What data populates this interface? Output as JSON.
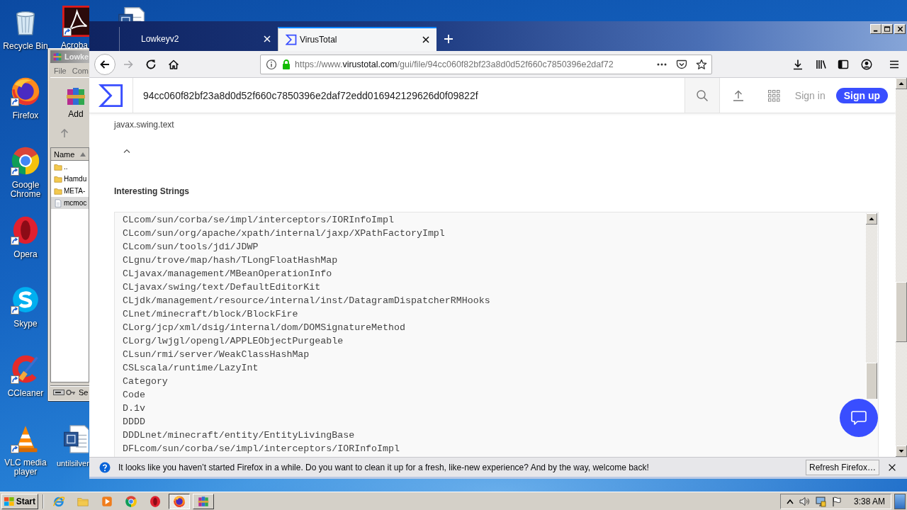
{
  "desktop_icons": [
    {
      "label": "Recycle Bin",
      "kind": "bin",
      "shortcut": false
    },
    {
      "label": "Firefox",
      "kind": "firefox",
      "shortcut": true
    },
    {
      "label": "Google Chrome",
      "kind": "chrome",
      "shortcut": true
    },
    {
      "label": "Opera",
      "kind": "opera",
      "shortcut": true
    },
    {
      "label": "Skype",
      "kind": "skype",
      "shortcut": true
    },
    {
      "label": "CCleaner",
      "kind": "ccleaner",
      "shortcut": true
    },
    {
      "label": "VLC media player",
      "kind": "vlc",
      "shortcut": true
    }
  ],
  "desktop_icons_partly_hidden": [
    {
      "label": "Acroba",
      "kind": "pdf",
      "shortcut": true
    },
    {
      "kind": "document",
      "shortcut": false
    },
    {
      "label": "untilsilver",
      "kind": "document",
      "shortcut": false
    }
  ],
  "archive_window": {
    "title": "Lowke",
    "menu": [
      "File",
      "Com"
    ],
    "toolbar": [
      "Add"
    ],
    "column": "Name",
    "files": [
      {
        "name": "..",
        "kind": "folder",
        "selected": false
      },
      {
        "name": "Hamdu",
        "kind": "folder",
        "selected": false
      },
      {
        "name": "META-",
        "kind": "folder",
        "selected": false
      },
      {
        "name": "mcmoc",
        "kind": "file",
        "selected": true
      }
    ],
    "status": "Se"
  },
  "browser": {
    "tabs": [
      {
        "label": "Lowkeyv2",
        "icon": false,
        "selected": false
      },
      {
        "label": "VirusTotal",
        "icon": true,
        "selected": true
      }
    ],
    "nav_buttons": [
      {
        "kind": "back",
        "disabled": false
      },
      {
        "kind": "forward",
        "disabled": true
      },
      {
        "kind": "reload",
        "disabled": false
      },
      {
        "kind": "home",
        "disabled": false
      }
    ],
    "url": [
      {
        "text": "https://www.",
        "emphasis": false
      },
      {
        "text": "virustotal.com",
        "emphasis": true
      },
      {
        "text": "/gui/file/94cc060f82bf23a8d0d52f660c7850396e2daf72",
        "emphasis": false
      }
    ]
  },
  "page": {
    "search_value": "94cc060f82bf23a8d0d52f660c7850396e2daf72edd016942129626d0f09822f",
    "sign_in": "Sign in",
    "sign_up": "Sign up",
    "previous_entry": "javax.swing.text",
    "section_title": "Interesting Strings",
    "strings": [
      "CLcom/sun/corba/se/impl/interceptors/IORInfoImpl",
      "CLcom/sun/org/apache/xpath/internal/jaxp/XPathFactoryImpl",
      "CLcom/sun/tools/jdi/JDWP",
      "CLgnu/trove/map/hash/TLongFloatHashMap",
      "CLjavax/management/MBeanOperationInfo",
      "CLjavax/swing/text/DefaultEditorKit",
      "CLjdk/management/resource/internal/inst/DatagramDispatcherRMHooks",
      "CLnet/minecraft/block/BlockFire",
      "CLorg/jcp/xml/dsig/internal/dom/DOMSignatureMethod",
      "CLorg/lwjgl/opengl/APPLEObjectPurgeable",
      "CLsun/rmi/server/WeakClassHashMap",
      "CSLscala/runtime/LazyInt",
      "Category",
      "Code",
      "D.1v",
      "DDDD",
      "DDDLnet/minecraft/entity/EntityLivingBase",
      "DFLcom/sun/corba/se/impl/interceptors/IORInfoImpl"
    ]
  },
  "notification": {
    "message": "It looks like you haven’t started Firefox in a while. Do you want to clean it up for a fresh, like-new experience? And by the way, welcome back!",
    "button": "Refresh Firefox…"
  },
  "taskbar": {
    "start": "Start",
    "apps": [
      {
        "kind": "ie",
        "running": false,
        "selected": false
      },
      {
        "kind": "explorer",
        "running": false,
        "selected": false
      },
      {
        "kind": "media",
        "running": false,
        "selected": false
      },
      {
        "kind": "chrome",
        "running": false,
        "selected": false
      },
      {
        "kind": "opera",
        "running": false,
        "selected": false
      },
      {
        "kind": "firefox",
        "running": true,
        "selected": true
      },
      {
        "kind": "winrar",
        "running": true,
        "selected": false
      }
    ],
    "clock": "3:38 AM"
  }
}
